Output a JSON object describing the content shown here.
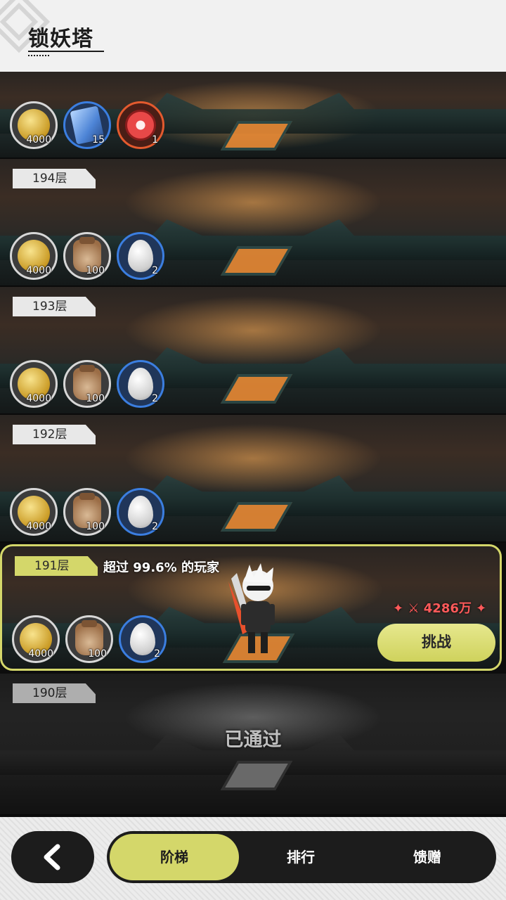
{
  "header": {
    "title": "锁妖塔"
  },
  "floors": [
    {
      "label": "",
      "rewards": [
        {
          "icon": "gold-coin-icon",
          "qty": "4000"
        },
        {
          "icon": "blue-card-icon",
          "qty": "15"
        },
        {
          "icon": "red-paw-token-icon",
          "qty": "1"
        }
      ]
    },
    {
      "label": "194层",
      "rewards": [
        {
          "icon": "gold-coin-icon",
          "qty": "4000"
        },
        {
          "icon": "grain-sack-icon",
          "qty": "100"
        },
        {
          "icon": "egg-icon",
          "qty": "2"
        }
      ]
    },
    {
      "label": "193层",
      "rewards": [
        {
          "icon": "gold-coin-icon",
          "qty": "4000"
        },
        {
          "icon": "grain-sack-icon",
          "qty": "100"
        },
        {
          "icon": "egg-icon",
          "qty": "2"
        }
      ]
    },
    {
      "label": "192层",
      "rewards": [
        {
          "icon": "gold-coin-icon",
          "qty": "4000"
        },
        {
          "icon": "grain-sack-icon",
          "qty": "100"
        },
        {
          "icon": "egg-icon",
          "qty": "2"
        }
      ]
    },
    {
      "label": "191层",
      "rewards": [
        {
          "icon": "gold-coin-icon",
          "qty": "4000"
        },
        {
          "icon": "grain-sack-icon",
          "qty": "100"
        },
        {
          "icon": "egg-icon",
          "qty": "2"
        }
      ],
      "surpass_text": "超过 99.6% 的玩家",
      "power": "4286万",
      "challenge_label": "挑战"
    },
    {
      "label": "190层",
      "status": "已通过"
    }
  ],
  "nav": {
    "back_icon": "chevron-left-icon",
    "tabs": [
      {
        "label": "阶梯",
        "active": true
      },
      {
        "label": "排行",
        "active": false
      },
      {
        "label": "馈赠",
        "active": false
      }
    ]
  },
  "colors": {
    "accent": "#d4d76a",
    "power": "#ff5a5a"
  }
}
